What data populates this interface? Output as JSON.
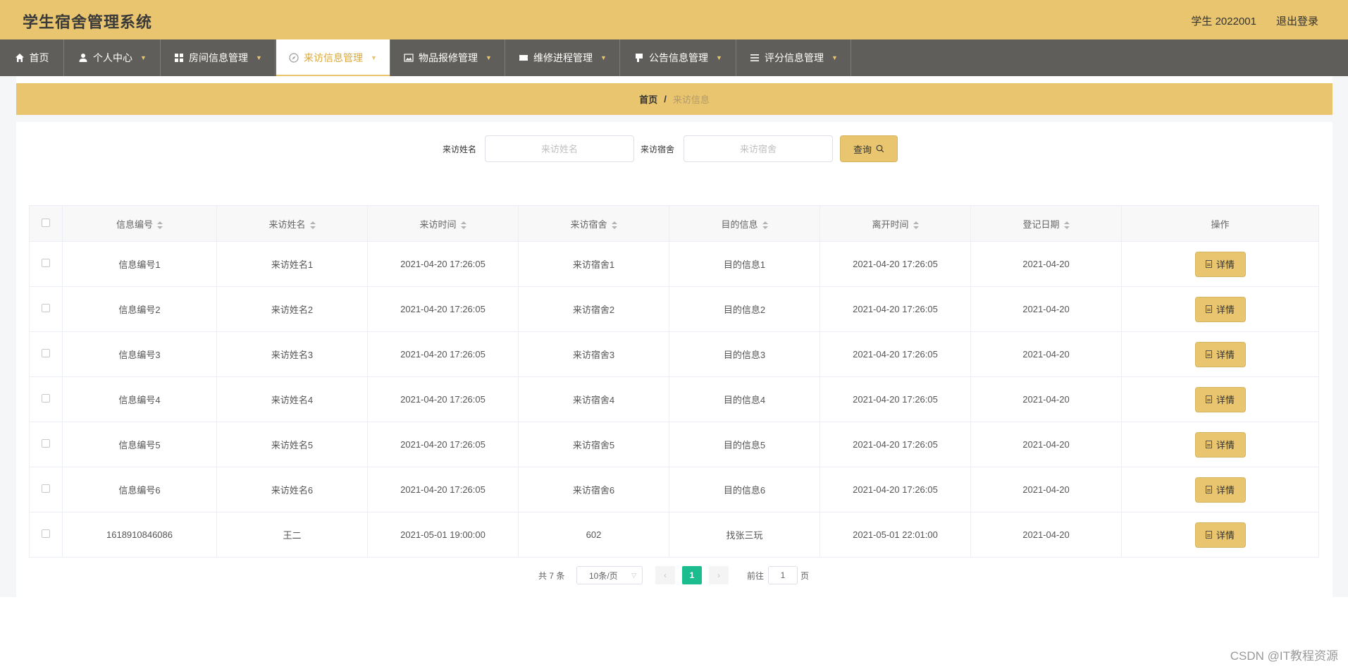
{
  "header": {
    "app_title": "学生宿舍管理系统",
    "user_info": "学生 2022001",
    "logout_label": "退出登录"
  },
  "nav": {
    "items": [
      {
        "label": "首页",
        "icon": "home-icon"
      },
      {
        "label": "个人中心",
        "icon": "user-icon"
      },
      {
        "label": "房间信息管理",
        "icon": "grid-icon"
      },
      {
        "label": "来访信息管理",
        "icon": "compass-icon"
      },
      {
        "label": "物品报修管理",
        "icon": "image-icon"
      },
      {
        "label": "维修进程管理",
        "icon": "ticket-icon"
      },
      {
        "label": "公告信息管理",
        "icon": "bookmark-icon"
      },
      {
        "label": "评分信息管理",
        "icon": "list-icon"
      }
    ],
    "active_index": 3
  },
  "breadcrumb": {
    "home": "首页",
    "separator": "/",
    "current": "来访信息"
  },
  "search": {
    "name_label": "来访姓名",
    "name_placeholder": "来访姓名",
    "dorm_label": "来访宿舍",
    "dorm_placeholder": "来访宿舍",
    "query_label": "查询"
  },
  "table": {
    "columns": [
      "信息编号",
      "来访姓名",
      "来访时间",
      "来访宿舍",
      "目的信息",
      "离开时间",
      "登记日期",
      "操作"
    ],
    "detail_label": "详情",
    "rows": [
      [
        "信息编号1",
        "来访姓名1",
        "2021-04-20 17:26:05",
        "来访宿舍1",
        "目的信息1",
        "2021-04-20 17:26:05",
        "2021-04-20"
      ],
      [
        "信息编号2",
        "来访姓名2",
        "2021-04-20 17:26:05",
        "来访宿舍2",
        "目的信息2",
        "2021-04-20 17:26:05",
        "2021-04-20"
      ],
      [
        "信息编号3",
        "来访姓名3",
        "2021-04-20 17:26:05",
        "来访宿舍3",
        "目的信息3",
        "2021-04-20 17:26:05",
        "2021-04-20"
      ],
      [
        "信息编号4",
        "来访姓名4",
        "2021-04-20 17:26:05",
        "来访宿舍4",
        "目的信息4",
        "2021-04-20 17:26:05",
        "2021-04-20"
      ],
      [
        "信息编号5",
        "来访姓名5",
        "2021-04-20 17:26:05",
        "来访宿舍5",
        "目的信息5",
        "2021-04-20 17:26:05",
        "2021-04-20"
      ],
      [
        "信息编号6",
        "来访姓名6",
        "2021-04-20 17:26:05",
        "来访宿舍6",
        "目的信息6",
        "2021-04-20 17:26:05",
        "2021-04-20"
      ],
      [
        "1618910846086",
        "王二",
        "2021-05-01 19:00:00",
        "602",
        "找张三玩",
        "2021-05-01 22:01:00",
        "2021-04-20"
      ]
    ]
  },
  "pagination": {
    "total_text": "共 7 条",
    "page_size": "10条/页",
    "current_page": "1",
    "goto_label": "前往",
    "goto_value": "1",
    "page_unit": "页"
  },
  "watermark": "CSDN @IT教程资源",
  "colors": {
    "accent": "#e8c56e",
    "nav_bg": "#5f5e5a",
    "page_active": "#1bbd8f"
  }
}
